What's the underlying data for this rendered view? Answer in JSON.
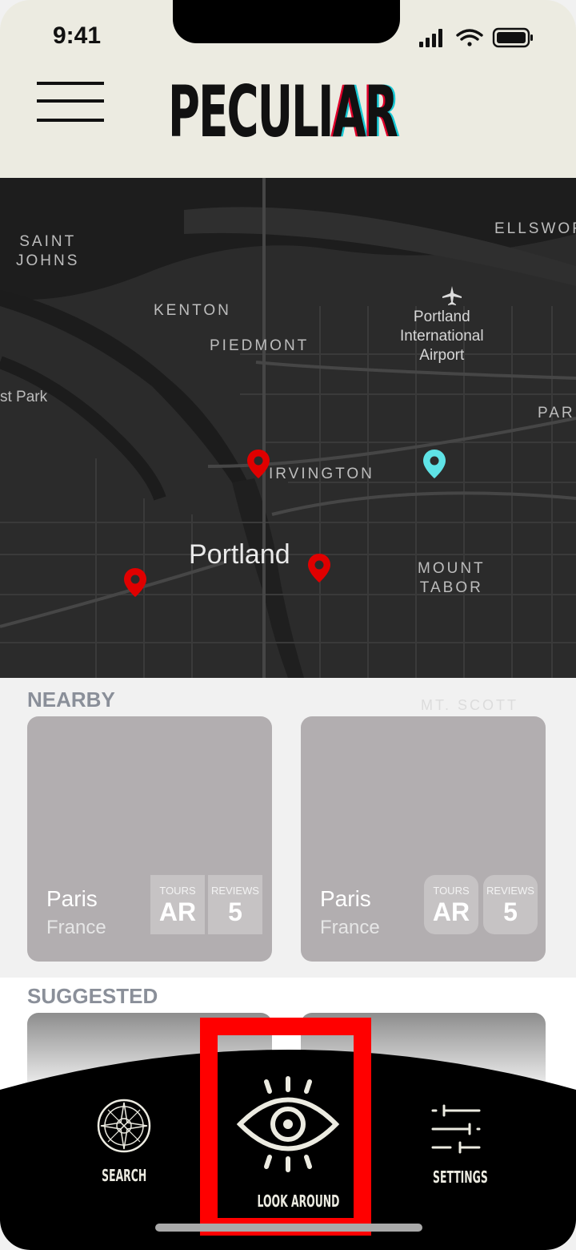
{
  "status_bar": {
    "time": "9:41"
  },
  "header": {
    "logo_main": "PECULI",
    "logo_accent": "AR",
    "menu_icon": "hamburger-menu-icon"
  },
  "map": {
    "labels": {
      "saint_johns": "SAINT\nJOHNS",
      "kenton": "KENTON",
      "piedmont": "PIEDMONT",
      "airport": "Portland\nInternational\nAirport",
      "ellsworth": "ELLSWOR",
      "forest_park": "st Park",
      "irvington": "IRVINGTON",
      "par": "PAR",
      "portland": "Portland",
      "mount_tabor": "MOUNT\nTABOR",
      "mt_scott": "MT. SCOTT"
    },
    "pins": [
      "red-location-pin",
      "red-location-pin",
      "red-location-pin",
      "cyan-location-pin"
    ],
    "colors": {
      "background": "#2b2b2b",
      "pin_red": "#e00000",
      "pin_cyan": "#5fe3e6"
    }
  },
  "nearby": {
    "title": "NEARBY",
    "cards": [
      {
        "city": "Paris",
        "country": "France",
        "tours_label": "TOURS",
        "tours_value": "AR",
        "reviews_label": "REVIEWS",
        "reviews_value": "5"
      },
      {
        "city": "Paris",
        "country": "France",
        "tours_label": "TOURS",
        "tours_value": "AR",
        "reviews_label": "REVIEWS",
        "reviews_value": "5"
      }
    ]
  },
  "suggested": {
    "title": "SUGGESTED"
  },
  "bottom_nav": {
    "items": [
      {
        "label": "SEARCH",
        "icon": "compass-icon"
      },
      {
        "label": "LOOK AROUND",
        "icon": "eye-icon",
        "active": true
      },
      {
        "label": "SETTINGS",
        "icon": "sliders-icon"
      }
    ],
    "highlight_color": "#ff0000"
  }
}
